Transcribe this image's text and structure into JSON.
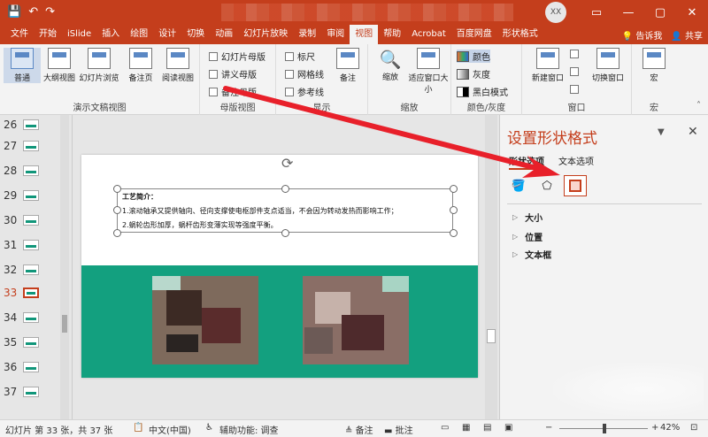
{
  "titlebar": {
    "qat": [
      "💾",
      "↶",
      "↷"
    ],
    "avatar": "XX",
    "window_buttons": [
      "▭",
      "—",
      "▢",
      "✕"
    ]
  },
  "tabs": {
    "items": [
      "文件",
      "开始",
      "iSlide",
      "插入",
      "绘图",
      "设计",
      "切换",
      "动画",
      "幻灯片放映",
      "录制",
      "审阅",
      "视图",
      "帮助",
      "Acrobat",
      "百度网盘",
      "形状格式"
    ],
    "active_index": 11,
    "tell_me": "告诉我",
    "share": "共享"
  },
  "ribbon": {
    "views": {
      "buttons": [
        "普通",
        "大纲视图",
        "幻灯片浏览",
        "备注页",
        "阅读视图"
      ],
      "label": "演示文稿视图"
    },
    "master": {
      "items": [
        "幻灯片母版",
        "讲义母版",
        "备注母版"
      ],
      "label": "母版视图"
    },
    "show": {
      "items": [
        "标尺",
        "网格线",
        "参考线"
      ],
      "notes": "备注",
      "label": "显示"
    },
    "zoom": {
      "zoom": "缩放",
      "fit": "适应窗口大小",
      "label": "缩放"
    },
    "color": {
      "items": [
        "颜色",
        "灰度",
        "黑白模式"
      ],
      "label": "颜色/灰度"
    },
    "window": {
      "new_window": "新建窗口",
      "switch_window": "切换窗口",
      "label": "窗口"
    },
    "macro": {
      "button": "宏",
      "label": "宏"
    }
  },
  "thumbnails": {
    "numbers": [
      "26",
      "27",
      "28",
      "29",
      "30",
      "31",
      "32",
      "33",
      "34",
      "35",
      "36",
      "37"
    ],
    "active": "33"
  },
  "slide": {
    "heading": "工艺简介：",
    "line1": "1.滚动轴承又提供轴向、径向支撑使电枢部件支点适当，不会因为转动发热而影响工作；",
    "line2": "2.蜗轮齿形加厚，蜗杆齿形变薄实现等强度平衡。"
  },
  "pane": {
    "title": "设置形状格式",
    "tab_shape": "形状选项",
    "tab_text": "文本选项",
    "icons": [
      "fill-line",
      "effects",
      "size-properties"
    ],
    "sections": [
      "大小",
      "位置",
      "文本框"
    ]
  },
  "status": {
    "slide_info": "幻灯片 第 33 张，共 37 张",
    "language": "中文(中国)",
    "accessibility": "辅助功能: 调查",
    "notes": "备注",
    "comments": "批注",
    "zoom": "42%"
  },
  "colors": {
    "accent": "#c43e1c",
    "slide_band": "#13a07f",
    "arrow": "#e8202a"
  }
}
